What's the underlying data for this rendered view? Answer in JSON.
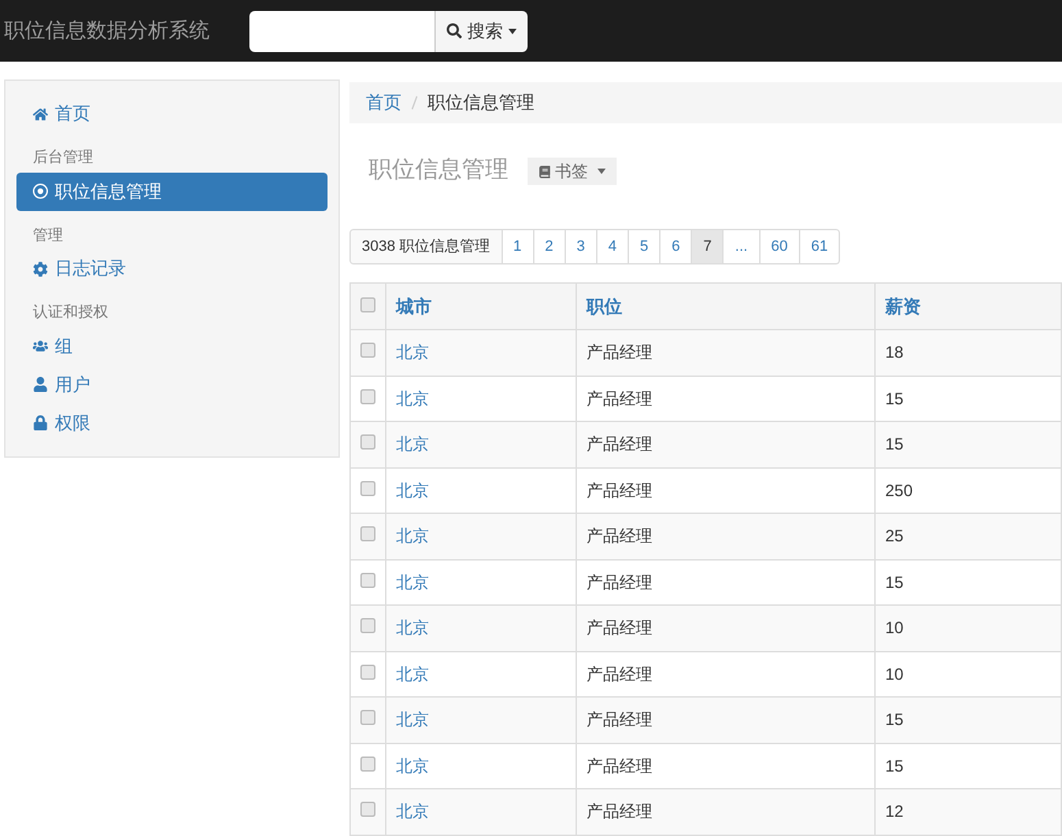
{
  "navbar": {
    "title": "职位信息数据分析系统",
    "search_button": "搜索"
  },
  "sidebar": {
    "items": [
      {
        "kind": "link",
        "label": "首页",
        "selected": false
      },
      {
        "kind": "header",
        "label": "后台管理"
      },
      {
        "kind": "link",
        "label": "职位信息管理",
        "selected": true
      },
      {
        "kind": "header",
        "label": "管理"
      },
      {
        "kind": "link",
        "label": "日志记录",
        "selected": false
      },
      {
        "kind": "header",
        "label": "认证和授权"
      },
      {
        "kind": "link",
        "label": "组",
        "selected": false
      },
      {
        "kind": "link",
        "label": "用户",
        "selected": false
      },
      {
        "kind": "link",
        "label": "权限",
        "selected": false
      }
    ]
  },
  "breadcrumb": [
    {
      "label": "首页",
      "kind": "link"
    },
    {
      "label": "职位信息管理",
      "kind": "current"
    }
  ],
  "page_title": "职位信息管理",
  "bookmark_button": "书签",
  "pagination": {
    "summary": "3038 职位信息管理",
    "pages": [
      {
        "label": "1",
        "selected": false
      },
      {
        "label": "2",
        "selected": false
      },
      {
        "label": "3",
        "selected": false
      },
      {
        "label": "4",
        "selected": false
      },
      {
        "label": "5",
        "selected": false
      },
      {
        "label": "6",
        "selected": false
      },
      {
        "label": "7",
        "selected": true
      },
      {
        "label": "...",
        "selected": false
      },
      {
        "label": "60",
        "selected": false
      },
      {
        "label": "61",
        "selected": false
      }
    ]
  },
  "table": {
    "header_checked": false,
    "columns": [
      "城市",
      "职位",
      "薪资"
    ],
    "rows": [
      {
        "checked": false,
        "cells": [
          "北京",
          "产品经理",
          "18"
        ]
      },
      {
        "checked": false,
        "cells": [
          "北京",
          "产品经理",
          "15"
        ]
      },
      {
        "checked": false,
        "cells": [
          "北京",
          "产品经理",
          "15"
        ]
      },
      {
        "checked": false,
        "cells": [
          "北京",
          "产品经理",
          "250"
        ]
      },
      {
        "checked": false,
        "cells": [
          "北京",
          "产品经理",
          "25"
        ]
      },
      {
        "checked": false,
        "cells": [
          "北京",
          "产品经理",
          "15"
        ]
      },
      {
        "checked": false,
        "cells": [
          "北京",
          "产品经理",
          "10"
        ]
      },
      {
        "checked": false,
        "cells": [
          "北京",
          "产品经理",
          "10"
        ]
      },
      {
        "checked": false,
        "cells": [
          "北京",
          "产品经理",
          "15"
        ]
      },
      {
        "checked": false,
        "cells": [
          "北京",
          "产品经理",
          "15"
        ]
      },
      {
        "checked": false,
        "cells": [
          "北京",
          "产品经理",
          "12"
        ]
      }
    ]
  }
}
